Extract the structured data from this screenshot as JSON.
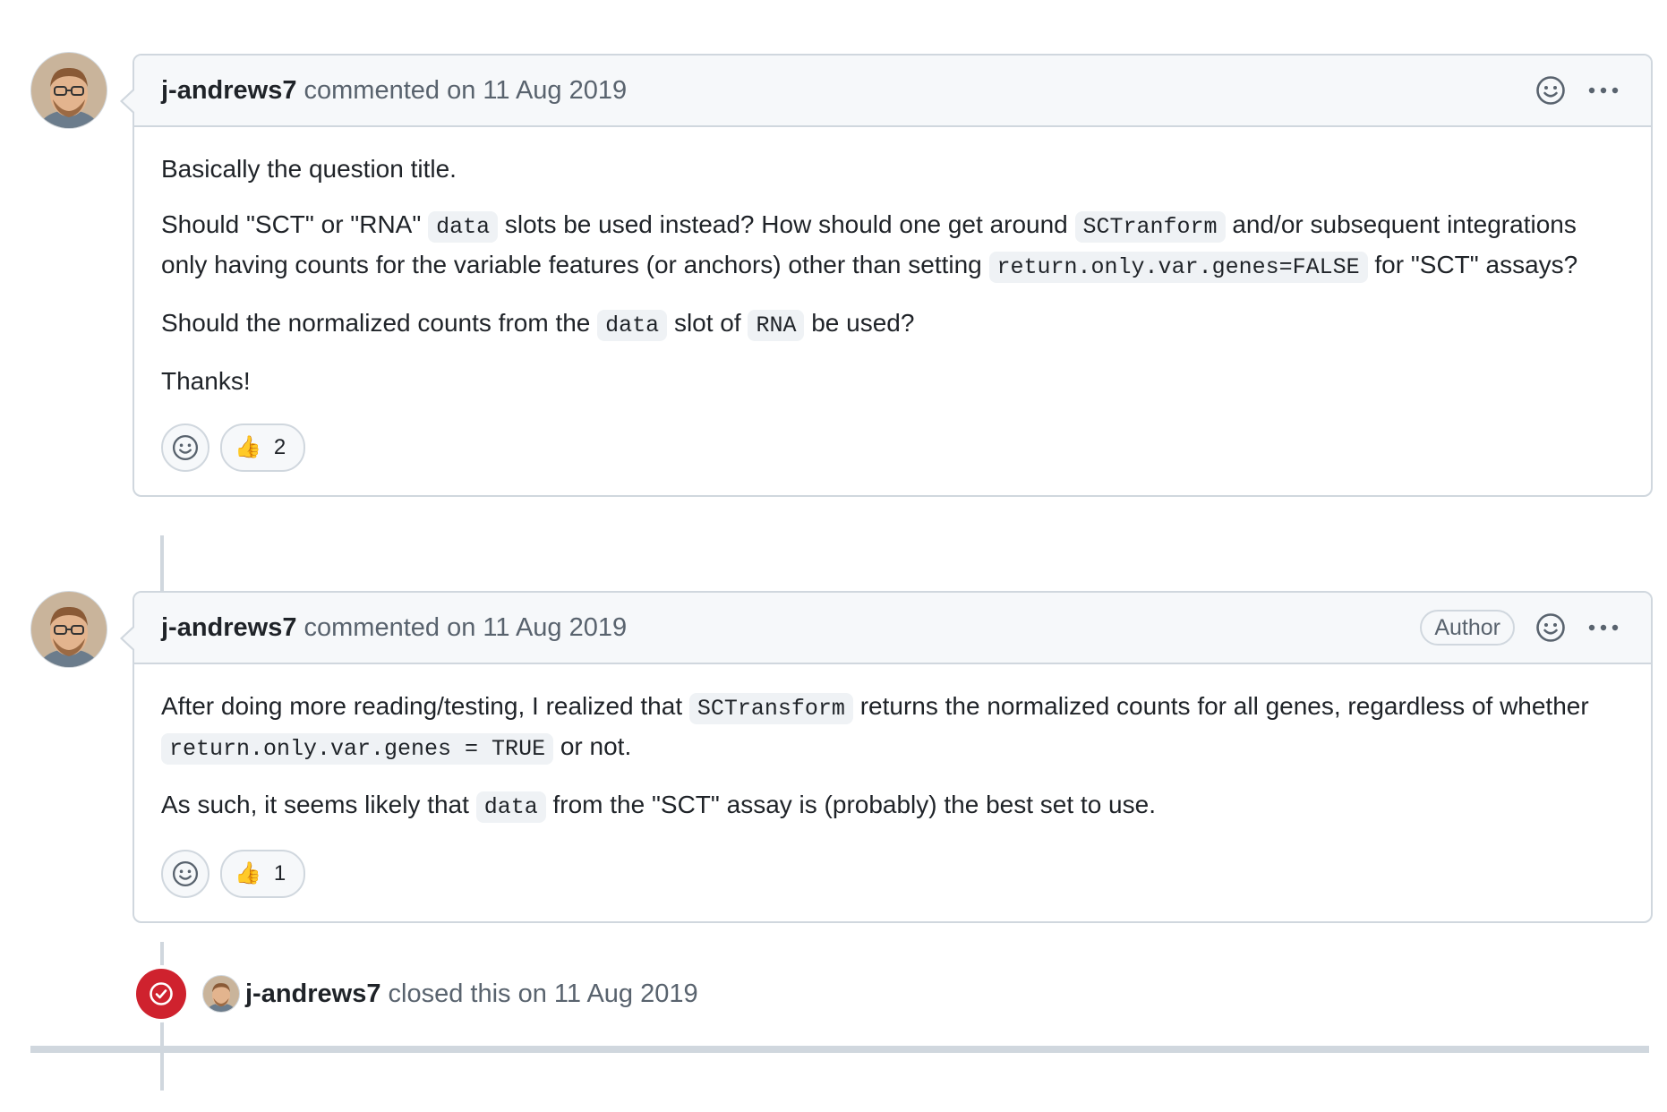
{
  "comments": [
    {
      "author": "j-andrews7",
      "meta": "commented on 11 Aug 2019",
      "author_badge": "",
      "body": [
        [
          {
            "t": "Basically the question title."
          }
        ],
        [
          {
            "t": "Should \"SCT\" or \"RNA\" "
          },
          {
            "c": "data"
          },
          {
            "t": " slots be used instead? How should one get around "
          },
          {
            "c": "SCTranform"
          },
          {
            "t": " and/or subsequent integrations only having counts for the variable features (or anchors) other than setting "
          },
          {
            "c": "return.only.var.genes=FALSE"
          },
          {
            "t": " for \"SCT\" assays?"
          }
        ],
        [
          {
            "t": "Should the normalized counts from the "
          },
          {
            "c": "data"
          },
          {
            "t": " slot of "
          },
          {
            "c": "RNA"
          },
          {
            "t": " be used?"
          }
        ],
        [
          {
            "t": "Thanks!"
          }
        ]
      ],
      "reaction": {
        "emoji": "👍",
        "count": "2"
      }
    },
    {
      "author": "j-andrews7",
      "meta": "commented on 11 Aug 2019",
      "author_badge": "Author",
      "body": [
        [
          {
            "t": "After doing more reading/testing, I realized that "
          },
          {
            "c": "SCTransform"
          },
          {
            "t": " returns the normalized counts for all genes, regardless of whether "
          },
          {
            "c": "return.only.var.genes = TRUE"
          },
          {
            "t": " or not."
          }
        ],
        [
          {
            "t": "As such, it seems likely that "
          },
          {
            "c": "data"
          },
          {
            "t": " from the \"SCT\" assay is (probably) the best set to use."
          }
        ]
      ],
      "reaction": {
        "emoji": "👍",
        "count": "1"
      }
    }
  ],
  "closed_event": {
    "author": "j-andrews7",
    "text": "closed this on 11 Aug 2019"
  },
  "icons": {
    "header_emoji": "smiley-icon",
    "header_more": "kebab-horizontal-icon",
    "add_reaction": "smiley-icon",
    "closed": "issue-closed-icon"
  },
  "colors": {
    "closed_badge": "#cf222e",
    "border": "#d0d7de",
    "header_bg": "#f6f8fa"
  }
}
